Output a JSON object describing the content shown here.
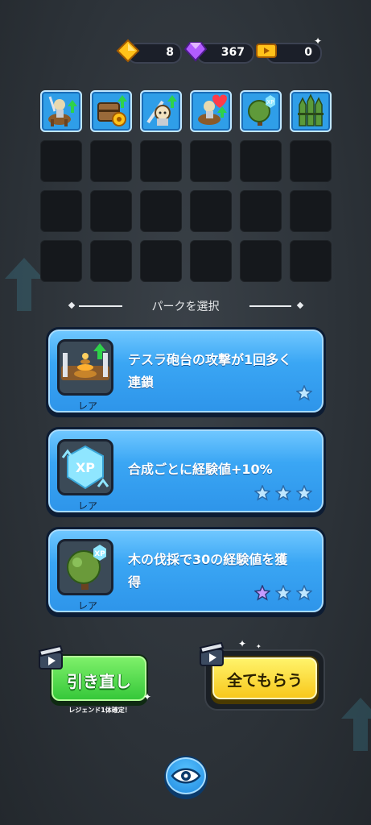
{
  "currency": {
    "gold": "8",
    "gems": "367",
    "tickets": "0"
  },
  "slots": {
    "unit_icons": [
      "knight-horse-icon",
      "chest-gear-icon",
      "soldier-sword-icon",
      "knight-heart-icon",
      "tree-xp-icon",
      "spike-fence-icon"
    ]
  },
  "perk_section": {
    "title": "パークを選択"
  },
  "perks": [
    {
      "icon": "tesla-turret-icon",
      "rarity": "レア",
      "description_line1": "テスラ砲台の攻撃が1回多く",
      "description_line2": "連鎖",
      "stars_filled": 1,
      "stars_total": 1
    },
    {
      "icon": "xp-crystal-icon",
      "rarity": "レア",
      "description_line1": "合成ごとに経験値+10%",
      "description_line2": "",
      "stars_filled": 0,
      "stars_total": 3
    },
    {
      "icon": "tree-xp-icon",
      "rarity": "レア",
      "description_line1": "木の伐採で30の経験値を獲",
      "description_line2": "得",
      "stars_filled": 1,
      "stars_total": 3
    }
  ],
  "buttons": {
    "reroll_label": "引き直し",
    "reroll_subtitle": "レジェンド1体確定！",
    "claim_all_label": "全てもらう"
  },
  "colors": {
    "card_blue": "#3aa6f4",
    "reroll_green": "#36c83a",
    "claim_yellow": "#f8c81c",
    "star_purple": "#c59bff"
  }
}
